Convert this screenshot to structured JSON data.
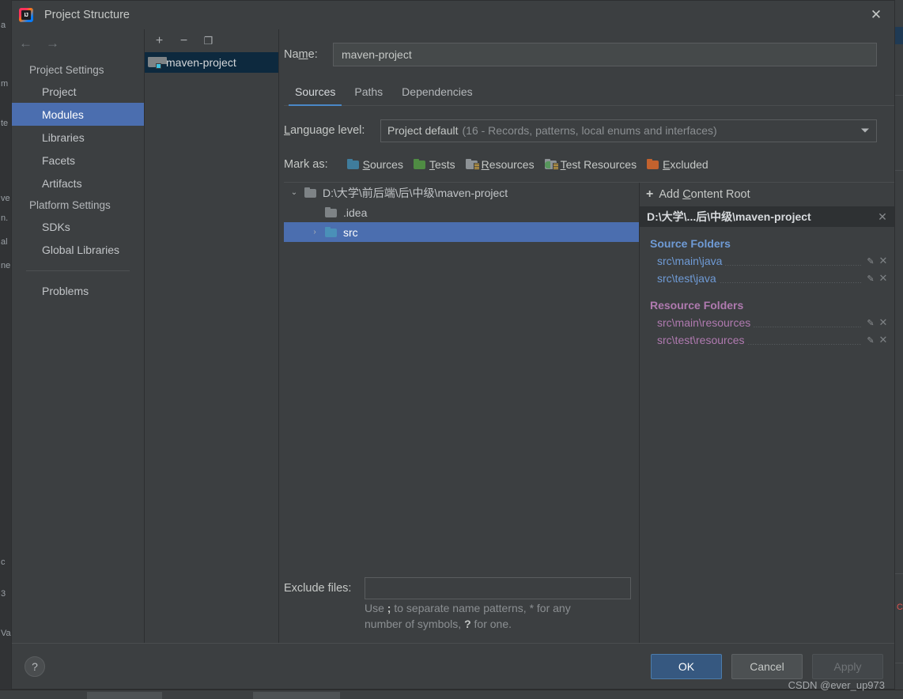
{
  "window": {
    "title": "Project Structure",
    "app_icon": "intellij-idea-icon",
    "close_label": "✕"
  },
  "sidebar": {
    "back_arrow": "←",
    "forward_arrow": "→",
    "groups": [
      {
        "label": "Project Settings",
        "items": [
          {
            "label": "Project",
            "selected": false
          },
          {
            "label": "Modules",
            "selected": true
          },
          {
            "label": "Libraries",
            "selected": false
          },
          {
            "label": "Facets",
            "selected": false
          },
          {
            "label": "Artifacts",
            "selected": false
          }
        ]
      },
      {
        "label": "Platform Settings",
        "items": [
          {
            "label": "SDKs",
            "selected": false
          },
          {
            "label": "Global Libraries",
            "selected": false
          }
        ]
      }
    ],
    "problems_label": "Problems"
  },
  "modules_panel": {
    "toolbar": {
      "add": "+",
      "remove": "−",
      "copy": "❐"
    },
    "items": [
      {
        "label": "maven-project",
        "selected": true
      }
    ]
  },
  "main": {
    "name_label": "Name:",
    "name_label_pre": "Na",
    "name_label_underlined": "m",
    "name_label_post": "e:",
    "name_value": "maven-project",
    "tabs": [
      {
        "label": "Sources",
        "active": true
      },
      {
        "label": "Paths",
        "active": false
      },
      {
        "label": "Dependencies",
        "active": false
      }
    ],
    "language_level": {
      "label_underlined": "L",
      "label_rest": "anguage level:",
      "value_main": "Project default",
      "value_sub": "(16 - Records, patterns, local enums and interfaces)"
    },
    "mark_as": {
      "label": "Mark as:",
      "options": [
        {
          "label": "Sources",
          "mnemonic": "S",
          "rest": "ources",
          "color": "#3f7c9c",
          "kind": "plain"
        },
        {
          "label": "Tests",
          "mnemonic": "T",
          "rest": "ests",
          "color": "#4f8c43",
          "kind": "plain"
        },
        {
          "label": "Resources",
          "mnemonic": "R",
          "rest": "esources",
          "color": "#8d9296",
          "kind": "lines"
        },
        {
          "label": "Test Resources",
          "mnemonic": "T",
          "rest": "est Resources",
          "color": "#8d9296",
          "kind": "lines-green"
        },
        {
          "label": "Excluded",
          "mnemonic": "E",
          "rest": "xcluded",
          "color": "#c2622e",
          "kind": "plain"
        }
      ]
    },
    "tree": [
      {
        "label": "D:\\大学\\前后端\\后\\中级\\maven-project",
        "indent": 0,
        "twisty": "⌄",
        "expanded": true,
        "selected": false,
        "color": "gray"
      },
      {
        "label": ".idea",
        "indent": 1,
        "twisty": "",
        "expanded": false,
        "selected": false,
        "color": "gray"
      },
      {
        "label": "src",
        "indent": 1,
        "twisty": "›",
        "expanded": false,
        "selected": true,
        "color": "blue"
      }
    ],
    "exclude": {
      "label": "Exclude files:",
      "value": "",
      "hint_1": "Use ",
      "hint_sep": ";",
      "hint_2": " to separate name patterns, * for any",
      "hint_3": "number of symbols, ",
      "hint_q": "?",
      "hint_4": " for one."
    }
  },
  "roots_panel": {
    "add_content_root": {
      "plus": "+",
      "pre": "Add ",
      "mnemonic": "C",
      "post": "ontent Root"
    },
    "content_root": {
      "path": "D:\\大学\\...后\\中级\\maven-project",
      "remove": "✕"
    },
    "groups": [
      {
        "title": "Source Folders",
        "kind": "src",
        "folders": [
          {
            "path": "src\\main\\java",
            "edit": "✎",
            "remove": "✕"
          },
          {
            "path": "src\\test\\java",
            "edit": "✎",
            "remove": "✕"
          }
        ]
      },
      {
        "title": "Resource Folders",
        "kind": "res",
        "folders": [
          {
            "path": "src\\main\\resources",
            "edit": "✎",
            "remove": "✕"
          },
          {
            "path": "src\\test\\resources",
            "edit": "✎",
            "remove": "✕"
          }
        ]
      }
    ]
  },
  "footer": {
    "help": "?",
    "ok": "OK",
    "cancel": "Cancel",
    "apply": "Apply",
    "watermark": "CSDN @ever_up973"
  },
  "colors": {
    "accent_blue": "#4b6eaf",
    "tab_underline": "#4a88c7",
    "source_folder": "#6f9bd6",
    "resource_folder": "#b07ab0",
    "dialog_bg": "#3c3f41",
    "selection_unfocused": "#0d293e"
  }
}
